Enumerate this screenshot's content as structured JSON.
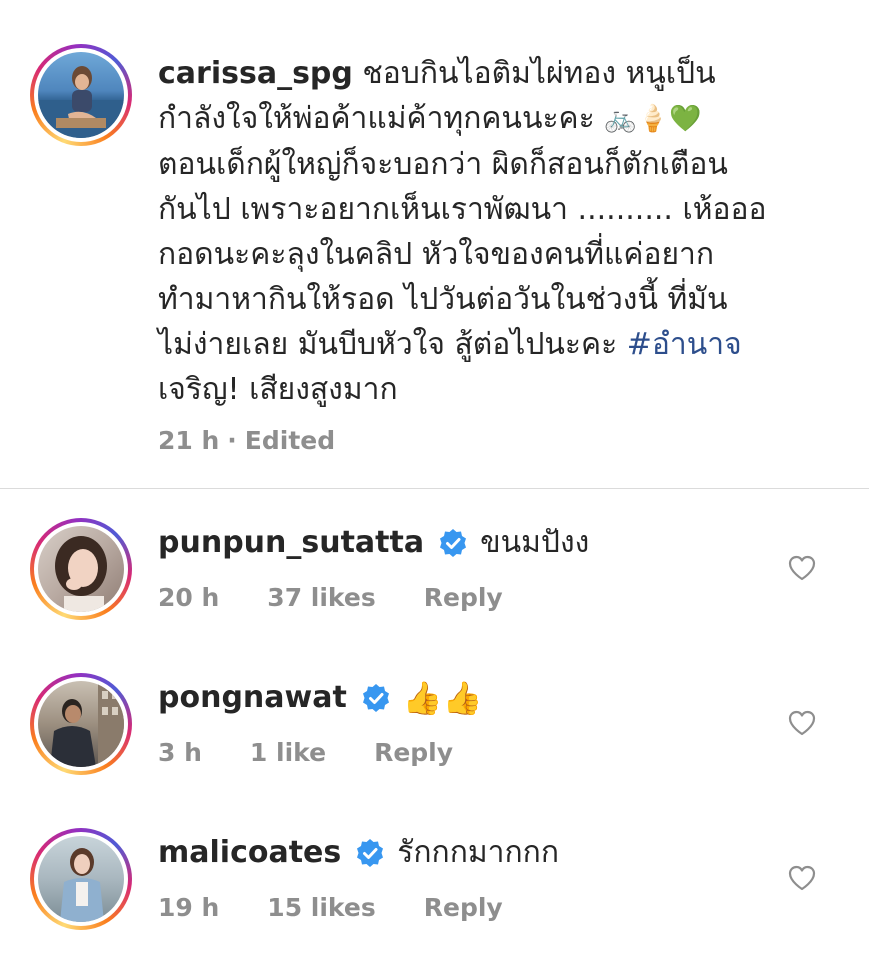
{
  "caption": {
    "username": "carissa_spg",
    "text_lines": [
      "ชอบกินไอติมไผ่ทอง หนูเป็น",
      "กำลังใจให้พ่อค้าแม่ค้าทุกคนนะคะ",
      "ตอนเด็กผู้ใหญ่ก็จะบอกว่า ผิดก็สอนก็ตักเตือน",
      "กันไป เพราะอยากเห็นเราพัฒนา .......... เห้อออ",
      "กอดนะคะลุงในคลิป หัวใจของคนที่แค่อยาก",
      "ทำมาหากินให้รอด ไปวันต่อวันในช่วงนี้ ที่มัน",
      "ไม่ง่ายเลย มันบีบหัวใจ สู้ต่อไปนะคะ",
      "เจริญ! เสียงสูงมาก"
    ],
    "emoji_line2": "🚲🍦💚",
    "hashtag": "#อำนาจ",
    "time": "21 h",
    "separator": "·",
    "edited": "Edited"
  },
  "replies": [
    {
      "username": "punpun_sutatta",
      "verified": true,
      "text": "ขนมปังง",
      "time": "20 h",
      "likes": "37 likes",
      "reply_label": "Reply"
    },
    {
      "username": "pongnawat",
      "verified": true,
      "text": "👍👍",
      "time": "3 h",
      "likes": "1 like",
      "reply_label": "Reply"
    },
    {
      "username": "malicoates",
      "verified": true,
      "text": "รักกกมากกก",
      "time": "19 h",
      "likes": "15 likes",
      "reply_label": "Reply"
    }
  ],
  "icons": {
    "verified": "verified-badge-icon",
    "heart": "heart-outline-icon"
  },
  "colors": {
    "text": "#262626",
    "meta": "#8e8e8e",
    "hashtag": "#2d4e8c",
    "verified": "#3897f0",
    "divider": "#dbdbdb"
  }
}
